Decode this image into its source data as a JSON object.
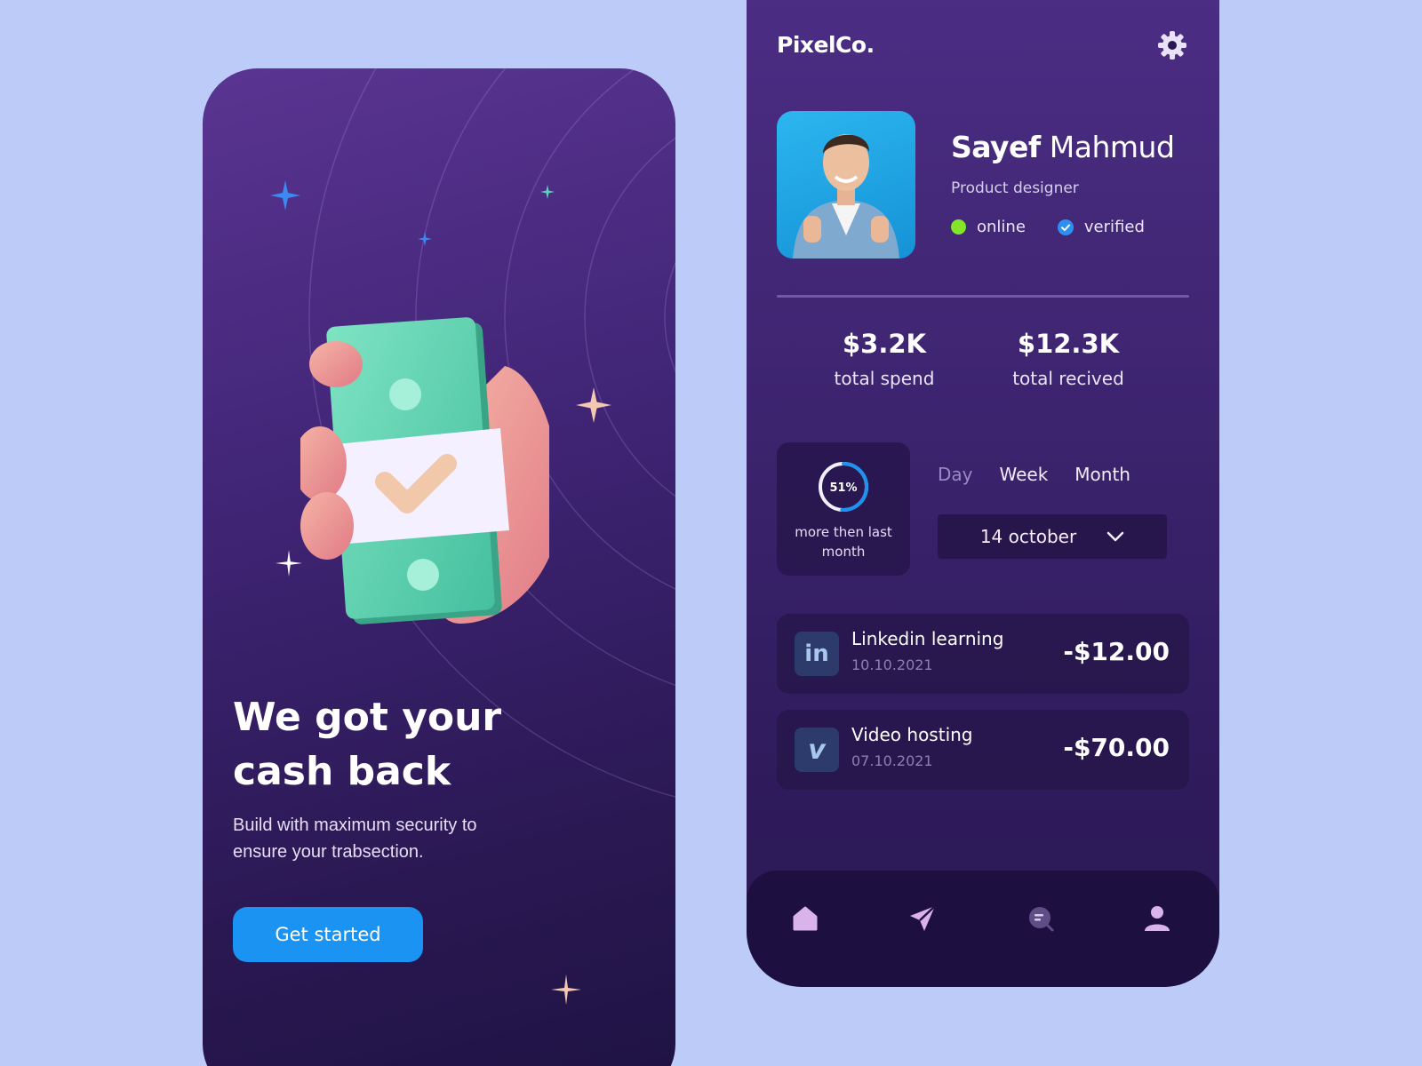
{
  "onboarding": {
    "title_line1": "We got your",
    "title_line2": "cash back",
    "subtitle_line1": "Build with maximum security to",
    "subtitle_line2": "ensure your trabsection.",
    "cta_label": "Get started",
    "illustration_icon": "cash-in-hand-icon"
  },
  "dashboard": {
    "brand": "PixelCo.",
    "settings_icon": "gear-icon",
    "profile": {
      "name_first": "Sayef",
      "name_last": "Mahmud",
      "role": "Product designer",
      "status_online": "online",
      "status_verified": "verified"
    },
    "stats": [
      {
        "value": "$3.2K",
        "label": "total spend"
      },
      {
        "value": "$12.3K",
        "label": "total recived"
      }
    ],
    "progress": {
      "percent_label": "51%",
      "percent_value": 0.51,
      "caption_line1": "more then last",
      "caption_line2": "month"
    },
    "period_tabs": [
      "Day",
      "Week",
      "Month"
    ],
    "date_select": "14 october",
    "transactions": [
      {
        "icon": "linkedin-icon",
        "icon_text": "in",
        "title": "Linkedin learning",
        "date": "10.10.2021",
        "amount": "-$12.00"
      },
      {
        "icon": "vimeo-icon",
        "icon_text": "v",
        "title": "Video hosting",
        "date": "07.10.2021",
        "amount": "-$70.00"
      }
    ],
    "nav": [
      "home-icon",
      "send-icon",
      "chat-icon",
      "profile-icon"
    ]
  },
  "colors": {
    "background": "#bccbf8",
    "accent_blue": "#1b93f2",
    "online_green": "#83e52a",
    "panel_purple": "#3f2474"
  }
}
